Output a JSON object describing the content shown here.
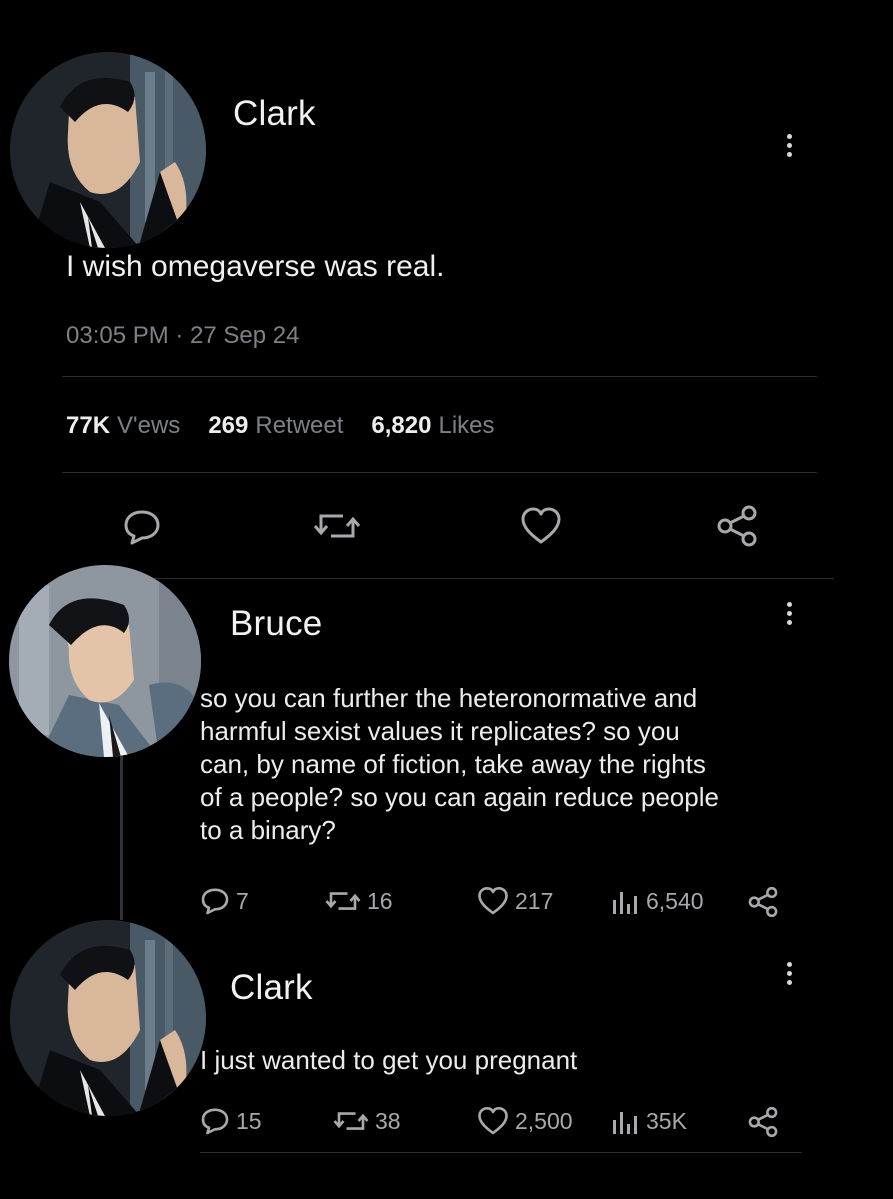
{
  "tweet": {
    "author": "Clark",
    "text": "I wish omegaverse was real.",
    "time": "03:05 PM · 27 Sep 24",
    "stats": {
      "views_count": "77K",
      "views_label": "V'ews",
      "retweets_count": "269",
      "retweets_label": "Retweet",
      "likes_count": "6,820",
      "likes_label": "Likes"
    }
  },
  "replies": [
    {
      "author": "Bruce",
      "text_lines": [
        "so you can further the heteronormative and",
        "harmful sexist values it replicates? so you",
        "can, by name of fiction, take away the rights",
        "of a people? so you can again reduce people",
        "to a binary?"
      ],
      "replies": "7",
      "retweets": "16",
      "likes": "217",
      "views": "6,540"
    },
    {
      "author": "Clark",
      "text_lines": [
        "I just wanted to get you pregnant"
      ],
      "replies": "15",
      "retweets": "38",
      "likes": "2,500",
      "views": "35K"
    }
  ],
  "icons": {
    "reply": "comment-icon",
    "retweet": "retweet-icon",
    "like": "heart-icon",
    "views": "views-bar-icon",
    "share": "share-icon",
    "more": "more-vertical-icon"
  },
  "colors": {
    "background": "#000000",
    "text": "#e7e9ea",
    "muted": "#7d8086",
    "icon": "#a7a9ad"
  }
}
